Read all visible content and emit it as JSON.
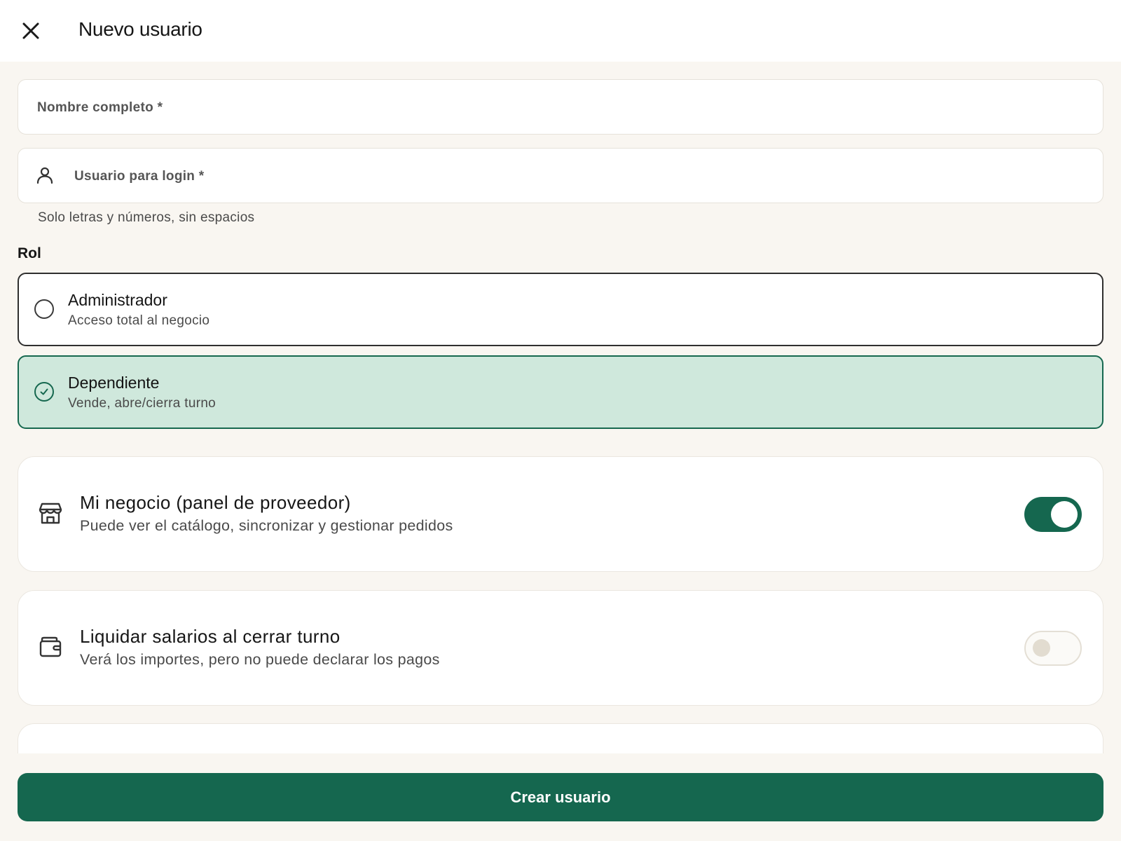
{
  "header": {
    "title": "Nuevo usuario",
    "close_icon": "close-icon"
  },
  "form": {
    "full_name": {
      "label": "Nombre completo *",
      "value": ""
    },
    "username": {
      "label": "Usuario para login *",
      "value": "",
      "icon": "user-icon",
      "helper": "Solo letras y números, sin espacios"
    }
  },
  "role": {
    "label": "Rol",
    "selected": "dependiente",
    "options": [
      {
        "id": "administrador",
        "title": "Administrador",
        "subtitle": "Acceso total al negocio",
        "selected": false
      },
      {
        "id": "dependiente",
        "title": "Dependiente",
        "subtitle": "Vende, abre/cierra turno",
        "selected": true
      }
    ]
  },
  "permissions": [
    {
      "icon": "store-icon",
      "title": "Mi negocio (panel de proveedor)",
      "subtitle": "Puede ver el catálogo, sincronizar y gestionar pedidos",
      "enabled": true
    },
    {
      "icon": "wallet-icon",
      "title": "Liquidar salarios al cerrar turno",
      "subtitle": "Verá los importes, pero no puede declarar los pagos",
      "enabled": false
    }
  ],
  "actions": {
    "submit_label": "Crear usuario"
  },
  "colors": {
    "primary": "#15674f",
    "selected_bg": "#cfe8dc",
    "page_bg": "#f9f6f1"
  }
}
